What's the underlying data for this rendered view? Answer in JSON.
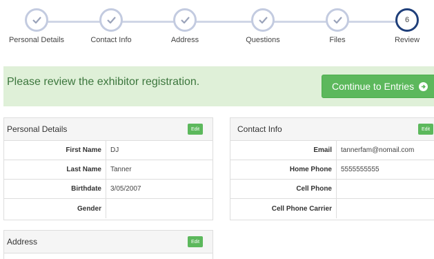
{
  "stepper": {
    "steps": [
      {
        "label": "Personal Details",
        "state": "complete"
      },
      {
        "label": "Contact Info",
        "state": "complete"
      },
      {
        "label": "Address",
        "state": "complete"
      },
      {
        "label": "Questions",
        "state": "complete"
      },
      {
        "label": "Files",
        "state": "complete"
      },
      {
        "label": "Review",
        "state": "current",
        "number": "6"
      }
    ]
  },
  "banner": {
    "message": "Please review the exhibitor registration.",
    "continue_label": "Continue to Entries"
  },
  "personal_details": {
    "title": "Personal Details",
    "edit_label": "Edit",
    "rows": [
      {
        "label": "First Name",
        "value": "DJ"
      },
      {
        "label": "Last Name",
        "value": "Tanner"
      },
      {
        "label": "Birthdate",
        "value": "3/05/2007"
      },
      {
        "label": "Gender",
        "value": ""
      }
    ]
  },
  "contact_info": {
    "title": "Contact Info",
    "edit_label": "Edit",
    "rows": [
      {
        "label": "Email",
        "value": "tannerfam@nomail.com"
      },
      {
        "label": "Home Phone",
        "value": "5555555555"
      },
      {
        "label": "Cell Phone",
        "value": ""
      },
      {
        "label": "Cell Phone Carrier",
        "value": ""
      }
    ]
  },
  "address": {
    "title": "Address",
    "edit_label": "Edit"
  },
  "colors": {
    "success": "#5cb85c",
    "banner_bg": "#dff0d8",
    "banner_text": "#3c763d",
    "step_current": "#1f3f7a",
    "step_done": "#c3cbe0"
  }
}
